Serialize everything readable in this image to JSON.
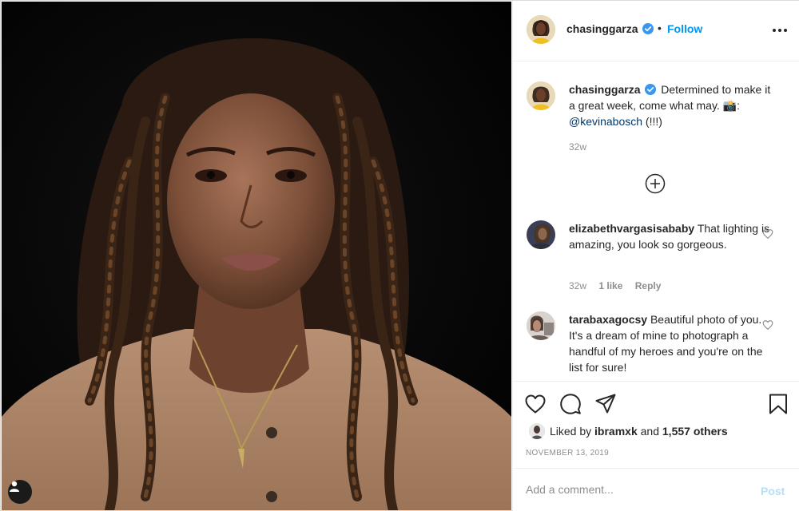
{
  "post": {
    "author": "chasinggarza",
    "follow_label": "Follow",
    "separator": "•"
  },
  "caption": {
    "username": "chasinggarza",
    "text": "Determined to make it a great week, come what may. 📸: ",
    "mention": "@kevinabosch",
    "suffix": " (!!!)",
    "time": "32w"
  },
  "comments": [
    {
      "username": "elizabethvargasisababy",
      "text": "That lighting is amazing, you look so gorgeous.",
      "time": "32w",
      "likes": "1 like",
      "reply": "Reply"
    },
    {
      "username": "tarabaxagocsy",
      "text": "Beautiful photo of you. It's a dream of mine to photograph a handful of my heroes and you're on the list for sure!"
    }
  ],
  "likes": {
    "prefix": "Liked by",
    "user": "ibramxk",
    "joiner": "and",
    "others": "1,557 others"
  },
  "date": "NOVEMBER 13, 2019",
  "composer": {
    "placeholder": "Add a comment...",
    "post_label": "Post"
  },
  "colors": {
    "link_blue": "#0095f6",
    "verified_blue": "#3897f0",
    "muted": "#8e8e8e",
    "post_disabled": "#b2dffc"
  },
  "icons": [
    "user-tag-icon",
    "verified-icon",
    "more-options-icon",
    "add-circle-icon",
    "heart-icon",
    "comment-icon",
    "share-icon",
    "bookmark-icon"
  ]
}
